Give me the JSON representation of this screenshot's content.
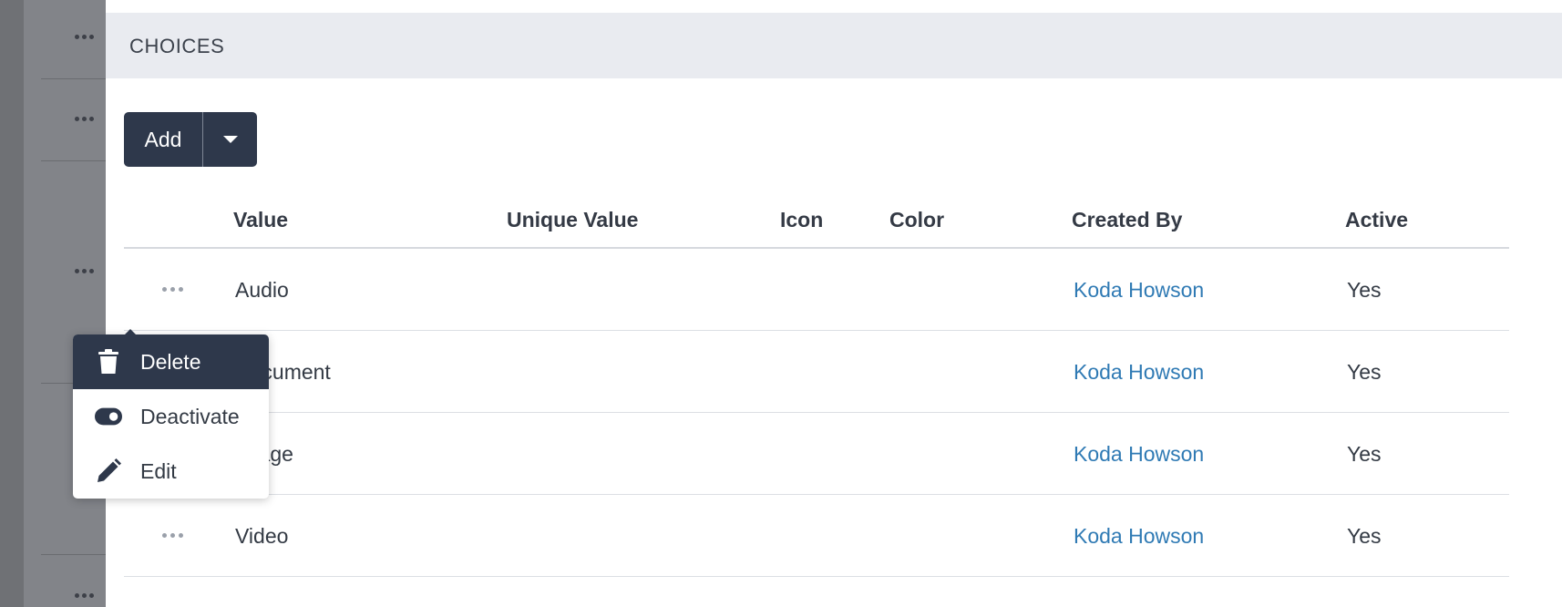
{
  "section": {
    "title": "CHOICES"
  },
  "add_button": {
    "label": "Add"
  },
  "table": {
    "headers": {
      "value": "Value",
      "unique_value": "Unique Value",
      "icon": "Icon",
      "color": "Color",
      "created_by": "Created By",
      "active": "Active"
    },
    "rows": [
      {
        "value": "Audio",
        "created_by": "Koda Howson",
        "active": "Yes"
      },
      {
        "value": "Document",
        "created_by": "Koda Howson",
        "active": "Yes"
      },
      {
        "value": "Image",
        "created_by": "Koda Howson",
        "active": "Yes"
      },
      {
        "value": "Video",
        "created_by": "Koda Howson",
        "active": "Yes"
      }
    ]
  },
  "row_menu": {
    "items": [
      {
        "label": "Delete",
        "icon": "trash-icon"
      },
      {
        "label": "Deactivate",
        "icon": "toggle-icon"
      },
      {
        "label": "Edit",
        "icon": "pencil-icon"
      }
    ]
  },
  "colors": {
    "primary_dark": "#2e384b",
    "link": "#2f7ab4",
    "header_bg": "#e9ebf0",
    "overlay": "#828489"
  }
}
